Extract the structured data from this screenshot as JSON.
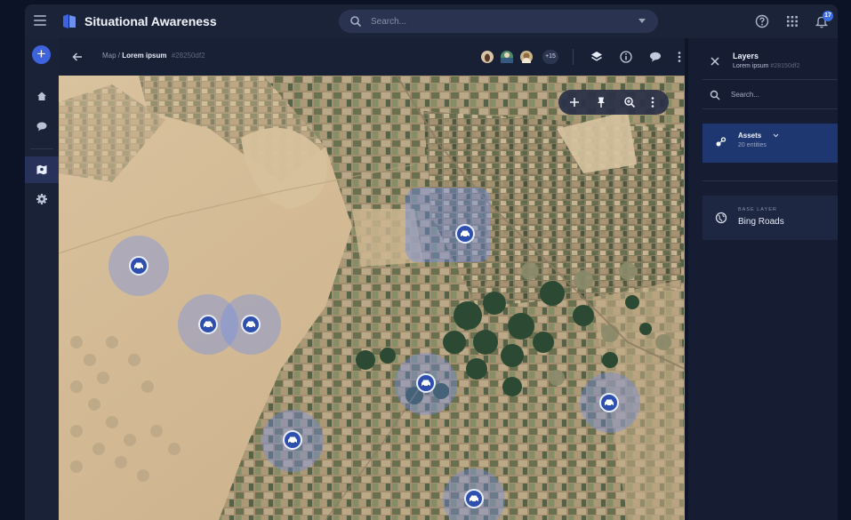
{
  "app": {
    "title": "Situational Awareness",
    "search_placeholder": "Search...",
    "notification_count": "17",
    "accent_color": "#3f63dd"
  },
  "rail": {
    "items": [
      {
        "icon": "home-icon"
      },
      {
        "icon": "chat-icon"
      },
      {
        "icon": "map-icon",
        "active": true
      },
      {
        "icon": "gear-icon"
      }
    ]
  },
  "map_header": {
    "breadcrumb_parent": "Map /",
    "breadcrumb_current": "Lorem ipsum",
    "breadcrumb_hash": "#28250df2",
    "avatars_extra": "+15"
  },
  "map": {
    "tools": [
      "plus-icon",
      "pin-icon",
      "zoom-icon",
      "more-vertical-icon"
    ],
    "asset_marker_count": 8
  },
  "panel": {
    "title": "Layers",
    "subtitle": "Lorem ipsum",
    "subtitle_hash": "#28150df2",
    "search_placeholder": "Search...",
    "assets": {
      "title": "Assets",
      "count": "20 entities"
    },
    "base_layer": {
      "label": "BASE LAYER",
      "value": "Bing Roads"
    }
  }
}
